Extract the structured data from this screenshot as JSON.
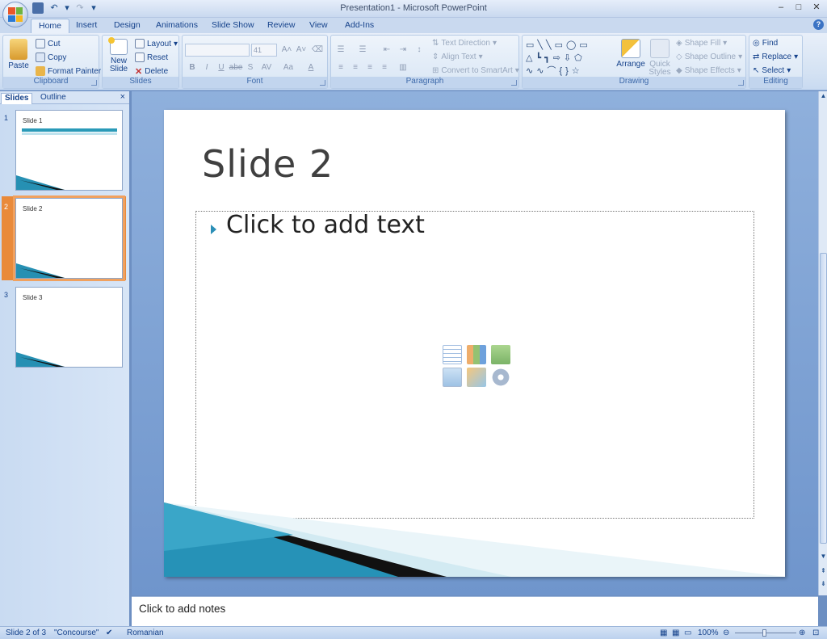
{
  "window": {
    "title": "Presentation1 - Microsoft PowerPoint"
  },
  "tabs": [
    "Home",
    "Insert",
    "Design",
    "Animations",
    "Slide Show",
    "Review",
    "View",
    "Add-Ins"
  ],
  "ribbon": {
    "clipboard": {
      "label": "Clipboard",
      "paste": "Paste",
      "cut": "Cut",
      "copy": "Copy",
      "format_painter": "Format Painter"
    },
    "slides": {
      "label": "Slides",
      "new_slide_1": "New",
      "new_slide_2": "Slide",
      "layout": "Layout",
      "reset": "Reset",
      "delete": "Delete"
    },
    "font": {
      "label": "Font",
      "size": "41"
    },
    "paragraph": {
      "label": "Paragraph",
      "text_direction": "Text Direction",
      "align_text": "Align Text",
      "convert_smartart": "Convert to SmartArt"
    },
    "drawing": {
      "label": "Drawing",
      "arrange": "Arrange",
      "quick_styles_1": "Quick",
      "quick_styles_2": "Styles",
      "shape_fill": "Shape Fill",
      "shape_outline": "Shape Outline",
      "shape_effects": "Shape Effects"
    },
    "editing": {
      "label": "Editing",
      "find": "Find",
      "replace": "Replace",
      "select": "Select"
    }
  },
  "panel": {
    "tabs": [
      "Slides",
      "Outline"
    ],
    "thumbnails": [
      {
        "number": "1",
        "title": "Slide 1"
      },
      {
        "number": "2",
        "title": "Slide 2"
      },
      {
        "number": "3",
        "title": "Slide 3"
      }
    ]
  },
  "slide": {
    "title": "Slide 2",
    "placeholder": "Click to add text"
  },
  "notes": {
    "placeholder": "Click to add notes"
  },
  "status": {
    "slide_info": "Slide 2 of 3",
    "theme": "\"Concourse\"",
    "language": "Romanian",
    "zoom": "100%"
  },
  "colors": {
    "accent_teal": "#1b8fb5",
    "selection_orange": "#e98a3a",
    "ribbon_text": "#15428b"
  }
}
